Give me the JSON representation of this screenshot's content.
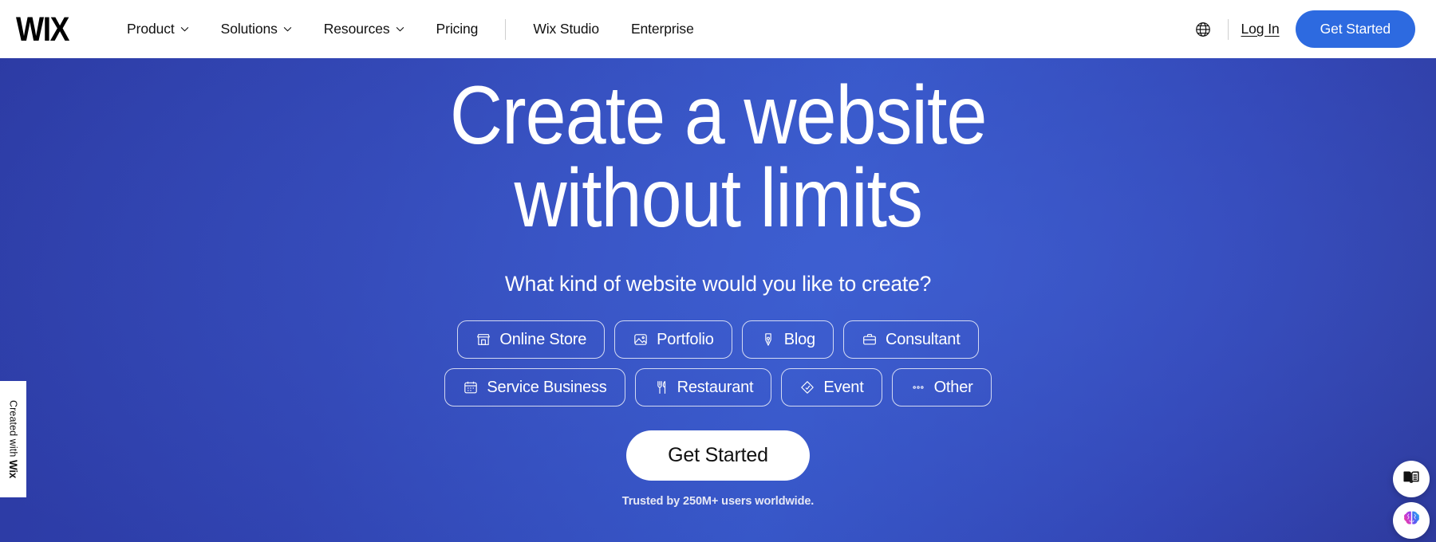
{
  "header": {
    "logo_text": "WIX",
    "nav_items": [
      {
        "label": "Product",
        "has_dropdown": true,
        "icon": "chevron-down-icon"
      },
      {
        "label": "Solutions",
        "has_dropdown": true,
        "icon": "chevron-down-icon"
      },
      {
        "label": "Resources",
        "has_dropdown": true,
        "icon": "chevron-down-icon"
      },
      {
        "label": "Pricing",
        "has_dropdown": false,
        "icon": ""
      }
    ],
    "nav_items_secondary": [
      {
        "label": "Wix Studio"
      },
      {
        "label": "Enterprise"
      }
    ],
    "language_icon": "globe-icon",
    "login_label": "Log In",
    "cta_label": "Get Started",
    "cta_color": "#2d6ae0",
    "background": "#ffffff",
    "text_color": "#111111"
  },
  "hero": {
    "headline_line1": "Create a website",
    "headline_line2": "without limits",
    "subheadline": "What kind of website would you like to create?",
    "cta_label": "Get Started",
    "trusted_text": "Trusted by 250M+ users worldwide.",
    "background_start": "#2c3aa3",
    "background_mid": "#3453c4",
    "background_end": "#2b3596",
    "text_color": "#ffffff",
    "categories_row1": [
      {
        "label": "Online Store",
        "icon": "storefront-icon"
      },
      {
        "label": "Portfolio",
        "icon": "image-icon"
      },
      {
        "label": "Blog",
        "icon": "pen-nib-icon"
      },
      {
        "label": "Consultant",
        "icon": "briefcase-icon"
      }
    ],
    "categories_row2": [
      {
        "label": "Service Business",
        "icon": "calendar-icon"
      },
      {
        "label": "Restaurant",
        "icon": "fork-knife-icon"
      },
      {
        "label": "Event",
        "icon": "ticket-icon"
      },
      {
        "label": "Other",
        "icon": "ellipsis-icon"
      }
    ]
  },
  "badge": {
    "prefix_text": "Created with ",
    "brand_text": "Wix"
  },
  "floating_widgets": [
    {
      "name": "open-book-icon",
      "label": ""
    },
    {
      "name": "ai-brain-icon",
      "label": ""
    }
  ]
}
